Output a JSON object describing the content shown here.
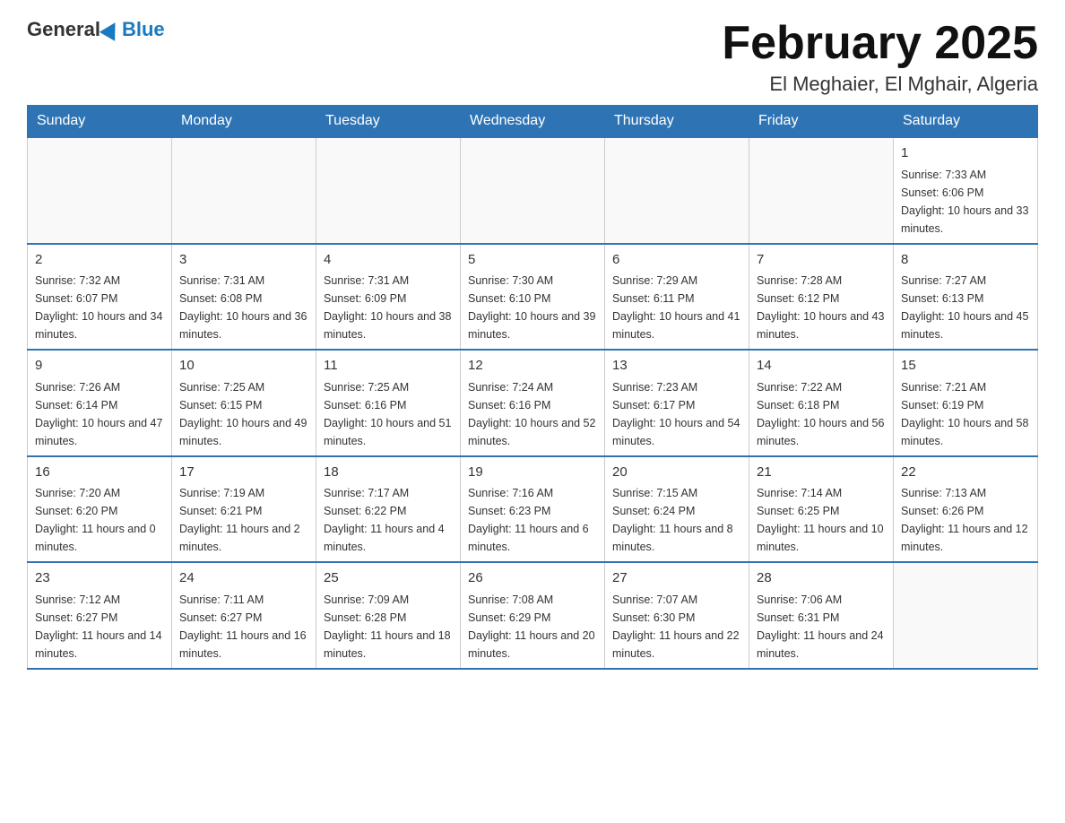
{
  "header": {
    "logo_general": "General",
    "logo_blue": "Blue",
    "month_title": "February 2025",
    "location": "El Meghaier, El Mghair, Algeria"
  },
  "days_of_week": [
    "Sunday",
    "Monday",
    "Tuesday",
    "Wednesday",
    "Thursday",
    "Friday",
    "Saturday"
  ],
  "weeks": [
    {
      "days": [
        {
          "num": "",
          "sunrise": "",
          "sunset": "",
          "daylight": ""
        },
        {
          "num": "",
          "sunrise": "",
          "sunset": "",
          "daylight": ""
        },
        {
          "num": "",
          "sunrise": "",
          "sunset": "",
          "daylight": ""
        },
        {
          "num": "",
          "sunrise": "",
          "sunset": "",
          "daylight": ""
        },
        {
          "num": "",
          "sunrise": "",
          "sunset": "",
          "daylight": ""
        },
        {
          "num": "",
          "sunrise": "",
          "sunset": "",
          "daylight": ""
        },
        {
          "num": "1",
          "sunrise": "Sunrise: 7:33 AM",
          "sunset": "Sunset: 6:06 PM",
          "daylight": "Daylight: 10 hours and 33 minutes."
        }
      ]
    },
    {
      "days": [
        {
          "num": "2",
          "sunrise": "Sunrise: 7:32 AM",
          "sunset": "Sunset: 6:07 PM",
          "daylight": "Daylight: 10 hours and 34 minutes."
        },
        {
          "num": "3",
          "sunrise": "Sunrise: 7:31 AM",
          "sunset": "Sunset: 6:08 PM",
          "daylight": "Daylight: 10 hours and 36 minutes."
        },
        {
          "num": "4",
          "sunrise": "Sunrise: 7:31 AM",
          "sunset": "Sunset: 6:09 PM",
          "daylight": "Daylight: 10 hours and 38 minutes."
        },
        {
          "num": "5",
          "sunrise": "Sunrise: 7:30 AM",
          "sunset": "Sunset: 6:10 PM",
          "daylight": "Daylight: 10 hours and 39 minutes."
        },
        {
          "num": "6",
          "sunrise": "Sunrise: 7:29 AM",
          "sunset": "Sunset: 6:11 PM",
          "daylight": "Daylight: 10 hours and 41 minutes."
        },
        {
          "num": "7",
          "sunrise": "Sunrise: 7:28 AM",
          "sunset": "Sunset: 6:12 PM",
          "daylight": "Daylight: 10 hours and 43 minutes."
        },
        {
          "num": "8",
          "sunrise": "Sunrise: 7:27 AM",
          "sunset": "Sunset: 6:13 PM",
          "daylight": "Daylight: 10 hours and 45 minutes."
        }
      ]
    },
    {
      "days": [
        {
          "num": "9",
          "sunrise": "Sunrise: 7:26 AM",
          "sunset": "Sunset: 6:14 PM",
          "daylight": "Daylight: 10 hours and 47 minutes."
        },
        {
          "num": "10",
          "sunrise": "Sunrise: 7:25 AM",
          "sunset": "Sunset: 6:15 PM",
          "daylight": "Daylight: 10 hours and 49 minutes."
        },
        {
          "num": "11",
          "sunrise": "Sunrise: 7:25 AM",
          "sunset": "Sunset: 6:16 PM",
          "daylight": "Daylight: 10 hours and 51 minutes."
        },
        {
          "num": "12",
          "sunrise": "Sunrise: 7:24 AM",
          "sunset": "Sunset: 6:16 PM",
          "daylight": "Daylight: 10 hours and 52 minutes."
        },
        {
          "num": "13",
          "sunrise": "Sunrise: 7:23 AM",
          "sunset": "Sunset: 6:17 PM",
          "daylight": "Daylight: 10 hours and 54 minutes."
        },
        {
          "num": "14",
          "sunrise": "Sunrise: 7:22 AM",
          "sunset": "Sunset: 6:18 PM",
          "daylight": "Daylight: 10 hours and 56 minutes."
        },
        {
          "num": "15",
          "sunrise": "Sunrise: 7:21 AM",
          "sunset": "Sunset: 6:19 PM",
          "daylight": "Daylight: 10 hours and 58 minutes."
        }
      ]
    },
    {
      "days": [
        {
          "num": "16",
          "sunrise": "Sunrise: 7:20 AM",
          "sunset": "Sunset: 6:20 PM",
          "daylight": "Daylight: 11 hours and 0 minutes."
        },
        {
          "num": "17",
          "sunrise": "Sunrise: 7:19 AM",
          "sunset": "Sunset: 6:21 PM",
          "daylight": "Daylight: 11 hours and 2 minutes."
        },
        {
          "num": "18",
          "sunrise": "Sunrise: 7:17 AM",
          "sunset": "Sunset: 6:22 PM",
          "daylight": "Daylight: 11 hours and 4 minutes."
        },
        {
          "num": "19",
          "sunrise": "Sunrise: 7:16 AM",
          "sunset": "Sunset: 6:23 PM",
          "daylight": "Daylight: 11 hours and 6 minutes."
        },
        {
          "num": "20",
          "sunrise": "Sunrise: 7:15 AM",
          "sunset": "Sunset: 6:24 PM",
          "daylight": "Daylight: 11 hours and 8 minutes."
        },
        {
          "num": "21",
          "sunrise": "Sunrise: 7:14 AM",
          "sunset": "Sunset: 6:25 PM",
          "daylight": "Daylight: 11 hours and 10 minutes."
        },
        {
          "num": "22",
          "sunrise": "Sunrise: 7:13 AM",
          "sunset": "Sunset: 6:26 PM",
          "daylight": "Daylight: 11 hours and 12 minutes."
        }
      ]
    },
    {
      "days": [
        {
          "num": "23",
          "sunrise": "Sunrise: 7:12 AM",
          "sunset": "Sunset: 6:27 PM",
          "daylight": "Daylight: 11 hours and 14 minutes."
        },
        {
          "num": "24",
          "sunrise": "Sunrise: 7:11 AM",
          "sunset": "Sunset: 6:27 PM",
          "daylight": "Daylight: 11 hours and 16 minutes."
        },
        {
          "num": "25",
          "sunrise": "Sunrise: 7:09 AM",
          "sunset": "Sunset: 6:28 PM",
          "daylight": "Daylight: 11 hours and 18 minutes."
        },
        {
          "num": "26",
          "sunrise": "Sunrise: 7:08 AM",
          "sunset": "Sunset: 6:29 PM",
          "daylight": "Daylight: 11 hours and 20 minutes."
        },
        {
          "num": "27",
          "sunrise": "Sunrise: 7:07 AM",
          "sunset": "Sunset: 6:30 PM",
          "daylight": "Daylight: 11 hours and 22 minutes."
        },
        {
          "num": "28",
          "sunrise": "Sunrise: 7:06 AM",
          "sunset": "Sunset: 6:31 PM",
          "daylight": "Daylight: 11 hours and 24 minutes."
        },
        {
          "num": "",
          "sunrise": "",
          "sunset": "",
          "daylight": ""
        }
      ]
    }
  ]
}
